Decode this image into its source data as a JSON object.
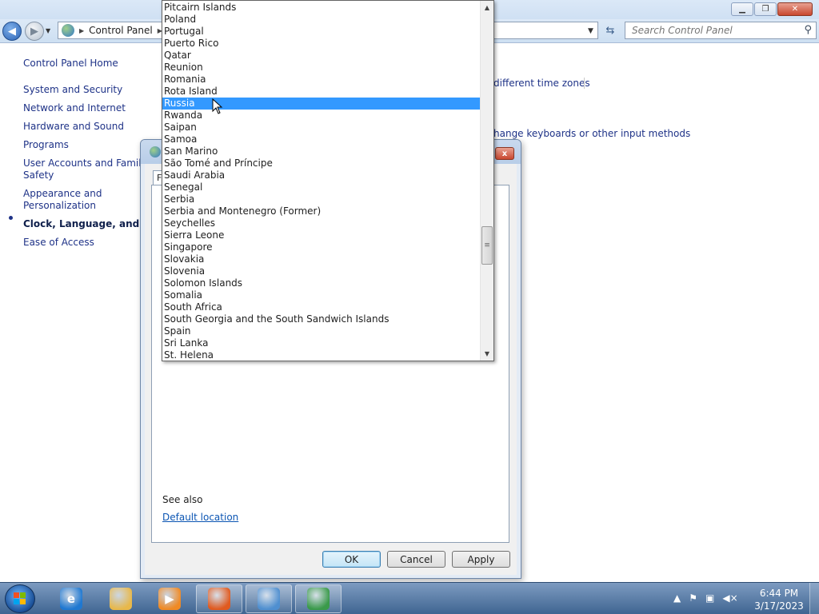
{
  "window": {
    "minimize_icon": "minimize-icon",
    "maximize_icon": "restore-icon",
    "close_icon": "close-icon"
  },
  "navbar": {
    "breadcrumb_root": "Control Panel",
    "search_placeholder": "Search Control Panel"
  },
  "leftnav": {
    "home": "Control Panel Home",
    "items": [
      {
        "label": "System and Security"
      },
      {
        "label": "Network and Internet"
      },
      {
        "label": "Hardware and Sound"
      },
      {
        "label": "Programs"
      },
      {
        "label": "User Accounts and Family Safety"
      },
      {
        "label": "Appearance and Personalization"
      },
      {
        "label": "Clock, Language, and Region"
      },
      {
        "label": "Ease of Access"
      }
    ],
    "active_index": 6
  },
  "main": {
    "link_time_zones": "different time zones",
    "link_keyboards": "hange keyboards or other input methods"
  },
  "dialog": {
    "close_label": "x",
    "tab_stub": "F",
    "see_also": "See also",
    "default_location": "Default location",
    "ok": "OK",
    "cancel": "Cancel",
    "apply": "Apply"
  },
  "dropdown": {
    "items": [
      "Pitcairn Islands",
      "Poland",
      "Portugal",
      "Puerto Rico",
      "Qatar",
      "Reunion",
      "Romania",
      "Rota Island",
      "Russia",
      "Rwanda",
      "Saipan",
      "Samoa",
      "San Marino",
      "São Tomé and Príncipe",
      "Saudi Arabia",
      "Senegal",
      "Serbia",
      "Serbia and Montenegro (Former)",
      "Seychelles",
      "Sierra Leone",
      "Singapore",
      "Slovakia",
      "Slovenia",
      "Solomon Islands",
      "Somalia",
      "South Africa",
      "South Georgia and the South Sandwich Islands",
      "Spain",
      "Sri Lanka",
      "St. Helena"
    ],
    "selected": "Russia",
    "scroll_position": 0.72
  },
  "taskbar": {
    "apps": [
      {
        "name": "internet-explorer-icon",
        "glyph": "e",
        "color": "#1f78d1",
        "running": false
      },
      {
        "name": "windows-explorer-icon",
        "glyph": "",
        "color": "#e8b84a",
        "running": false
      },
      {
        "name": "media-player-icon",
        "glyph": "▶",
        "color": "#f08a24",
        "running": false
      },
      {
        "name": "firefox-icon",
        "glyph": "",
        "color": "#e05a1f",
        "running": true
      },
      {
        "name": "control-panel-icon",
        "glyph": "",
        "color": "#4f8fd0",
        "running": true
      },
      {
        "name": "region-icon",
        "glyph": "",
        "color": "#3a9a4a",
        "running": true
      }
    ],
    "tray": {
      "show_hidden": "▲",
      "flag": "⚑",
      "network": "▣",
      "volume": "◀×"
    },
    "time": "6:44 PM",
    "date": "3/17/2023"
  }
}
